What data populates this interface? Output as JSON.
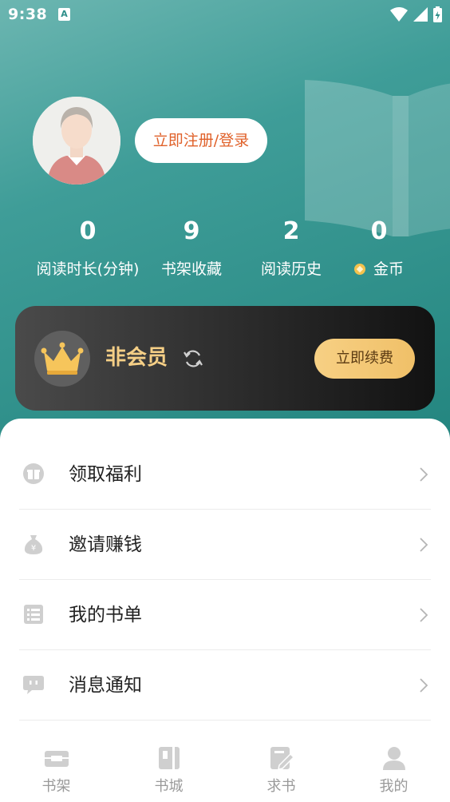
{
  "status_bar": {
    "time": "9:38",
    "keyboard_indicator": "A",
    "icons": [
      "wifi-icon",
      "signal-icon",
      "battery-icon"
    ]
  },
  "profile": {
    "avatar_icon": "default-avatar-icon",
    "login_label": "立即注册/登录"
  },
  "stats": [
    {
      "value": "0",
      "label": "阅读时长(分钟)"
    },
    {
      "value": "9",
      "label": "书架收藏"
    },
    {
      "value": "2",
      "label": "阅读历史"
    },
    {
      "value": "0",
      "label": "金币",
      "icon": "coin-icon"
    }
  ],
  "vip": {
    "status": "非会员",
    "renew_label": "立即续费",
    "crown_icon": "crown-icon",
    "refresh_icon": "refresh-icon"
  },
  "menu": [
    {
      "label": "领取福利",
      "icon": "gift-icon"
    },
    {
      "label": "邀请赚钱",
      "icon": "money-bag-icon"
    },
    {
      "label": "我的书单",
      "icon": "list-icon"
    },
    {
      "label": "消息通知",
      "icon": "message-icon"
    }
  ],
  "nav": [
    {
      "label": "书架",
      "icon": "bookshelf-icon"
    },
    {
      "label": "书城",
      "icon": "bookstore-icon"
    },
    {
      "label": "求书",
      "icon": "request-book-icon"
    },
    {
      "label": "我的",
      "icon": "profile-icon"
    }
  ],
  "colors": {
    "header_teal": "#2f8f8a",
    "login_text": "#e0612a",
    "vip_gold": "#f5cf86",
    "renew_button": "#f0c068",
    "nav_inactive": "#9a9a9a"
  }
}
